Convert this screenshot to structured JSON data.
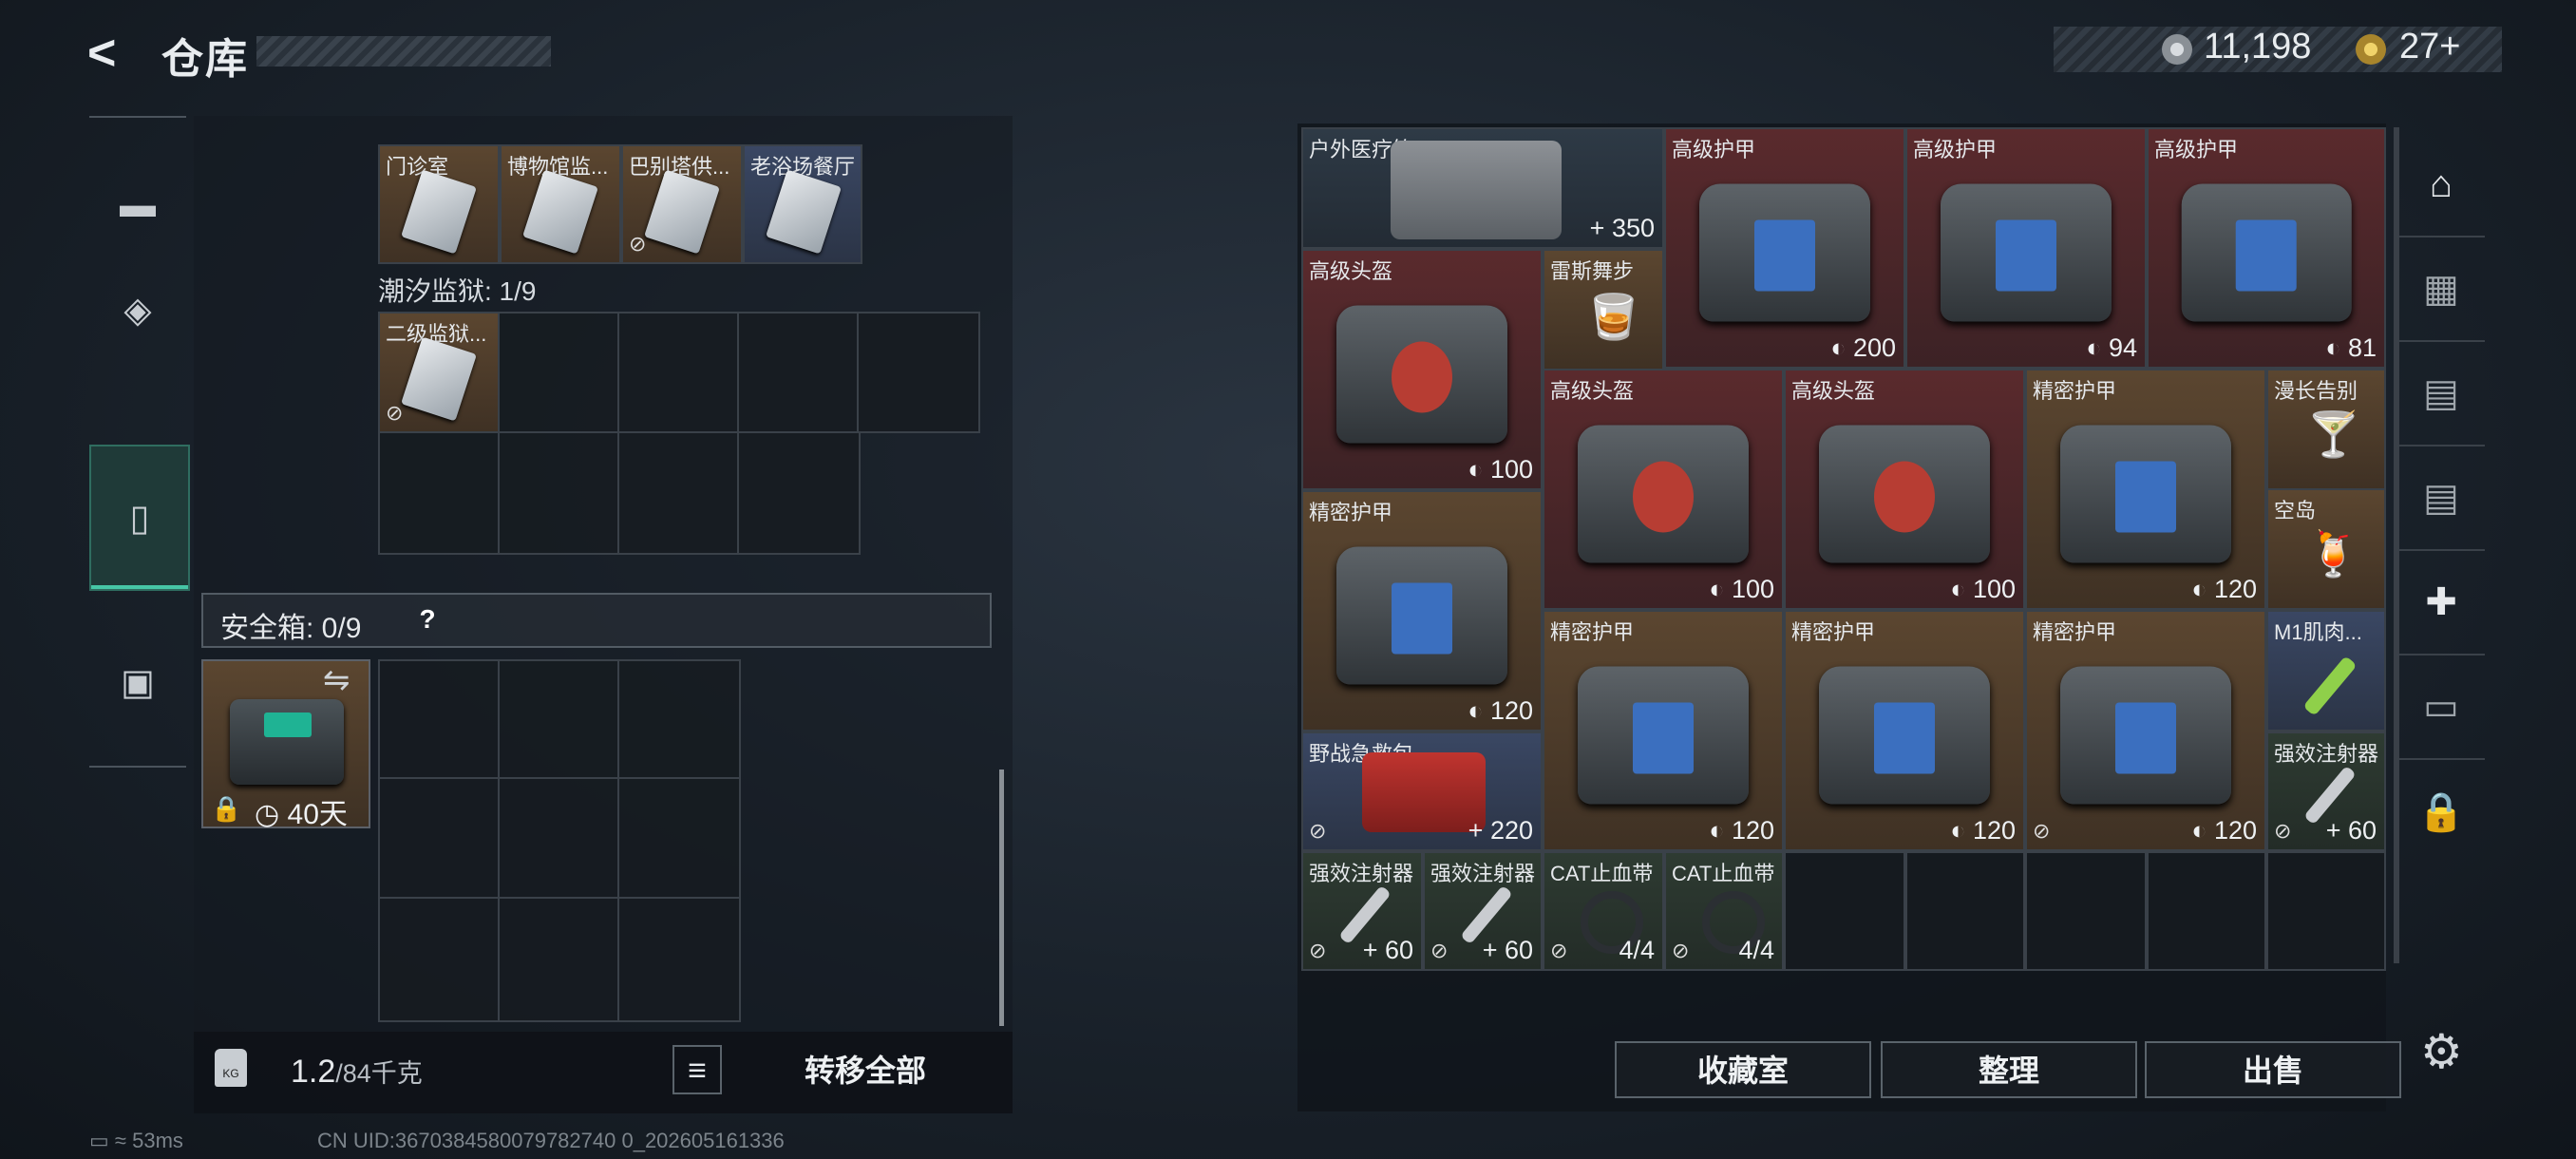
{
  "header": {
    "title": "仓库",
    "back_icon": "back-arrow-icon"
  },
  "currency": {
    "silver": "11,198",
    "gold": "27+"
  },
  "left_nav": [
    {
      "icon": "gun-icon"
    },
    {
      "icon": "armor-icon"
    },
    {
      "icon": "backpack-icon"
    },
    {
      "icon": "toolbox-icon"
    }
  ],
  "left_items_top": [
    {
      "label": "门诊室"
    },
    {
      "label": "博物馆监..."
    },
    {
      "label": "巴别塔供..."
    },
    {
      "label": "老浴场餐厅"
    }
  ],
  "prison_section": "潮汐监狱: 1/9",
  "prison_item": "二级监狱...",
  "safe_box": {
    "label": "安全箱: 0/9",
    "help": "?",
    "time": "40天"
  },
  "weight": {
    "current": "1.2",
    "max": "/84千克"
  },
  "buttons": {
    "transfer_all": "转移全部",
    "collection": "收藏室",
    "sort": "整理",
    "sell": "出售",
    "list": "≡"
  },
  "right_items": [
    {
      "label": "户外医疗箱",
      "value": "+ 350"
    },
    {
      "label": "高级护甲",
      "value": "200"
    },
    {
      "label": "高级护甲",
      "value": "94"
    },
    {
      "label": "高级护甲",
      "value": "81"
    },
    {
      "label": "高级头盔",
      "value": "100"
    },
    {
      "label": "雷斯舞步",
      "value": ""
    },
    {
      "label": "高级头盔",
      "value": "100"
    },
    {
      "label": "高级头盔",
      "value": "100"
    },
    {
      "label": "精密护甲",
      "value": "120"
    },
    {
      "label": "漫长告别",
      "value": ""
    },
    {
      "label": "精密护甲",
      "value": "120"
    },
    {
      "label": "空岛",
      "value": ""
    },
    {
      "label": "精密护甲",
      "value": "120"
    },
    {
      "label": "精密护甲",
      "value": "120"
    },
    {
      "label": "精密护甲",
      "value": "120"
    },
    {
      "label": "M1肌肉...",
      "value": ""
    },
    {
      "label": "野战急救包",
      "value": "+ 220"
    },
    {
      "label": "强效注射器",
      "value": "+ 60"
    },
    {
      "label": "强效注射器",
      "value": "+ 60"
    },
    {
      "label": "强效注射器",
      "value": "+ 60"
    },
    {
      "label": "CAT止血带",
      "value": "4/4"
    },
    {
      "label": "CAT止血带",
      "value": "4/4"
    }
  ],
  "status": {
    "ping": "53ms",
    "uid": "CN UID:3670384580079782740 0_202605161336"
  }
}
